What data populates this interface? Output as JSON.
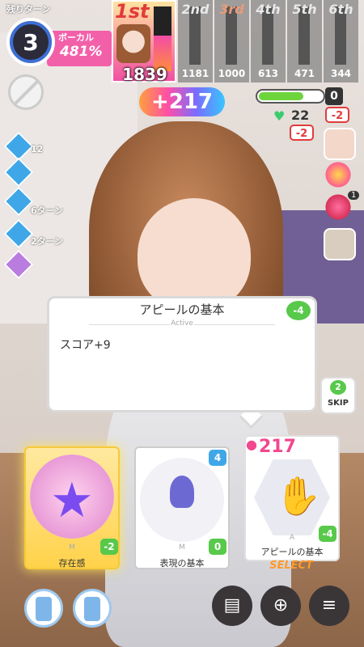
{
  "turn": {
    "label": "残りターン",
    "remaining": "3"
  },
  "vocal": {
    "label": "ボーカル",
    "value": "481%"
  },
  "ranking": {
    "first": {
      "place": "1st",
      "score": "1839"
    },
    "others": [
      {
        "place": "2nd",
        "score": "1181"
      },
      {
        "place": "3rd",
        "score": "1000"
      },
      {
        "place": "4th",
        "score": "613"
      },
      {
        "place": "5th",
        "score": "471"
      },
      {
        "place": "6th",
        "score": "344"
      }
    ]
  },
  "score_gain": "+217",
  "stamina": {
    "fill_fraction": 0.7,
    "shield": "0",
    "health": "22",
    "shield_delta": "-2",
    "health_delta": "-2"
  },
  "buffs": [
    {
      "icon": "mic-up-icon",
      "text": "12"
    },
    {
      "icon": "cycle-icon",
      "text": ""
    },
    {
      "icon": "shoe-icon",
      "text": "6ターン"
    },
    {
      "icon": "arrow-up-icon",
      "text": "2ターン"
    },
    {
      "icon": "plus-card-icon",
      "text": ""
    }
  ],
  "items": {
    "badge_count": "1"
  },
  "popup": {
    "title": "アピールの基本",
    "subtitle": "Active",
    "cost": "-4",
    "body": "スコア+9"
  },
  "skip": {
    "cost": "2",
    "label": "SKIP"
  },
  "cards": [
    {
      "name": "存在感",
      "tag": "M",
      "cost": "-2",
      "cost_color": "#58c94a",
      "top_badge": ""
    },
    {
      "name": "表現の基本",
      "tag": "M",
      "cost": "0",
      "cost_color": "#58c94a",
      "top_badge": "4"
    },
    {
      "name": "アピールの基本",
      "tag": "A",
      "cost": "-4",
      "cost_color": "#58c94a",
      "top_badge": "",
      "score": "217"
    }
  ],
  "select_label": "SELECT",
  "colors": {
    "accent_pink": "#f24fa2",
    "accent_blue": "#3fa7e8",
    "heart_green": "#58c94a",
    "select_orange": "#ff9a2a"
  }
}
